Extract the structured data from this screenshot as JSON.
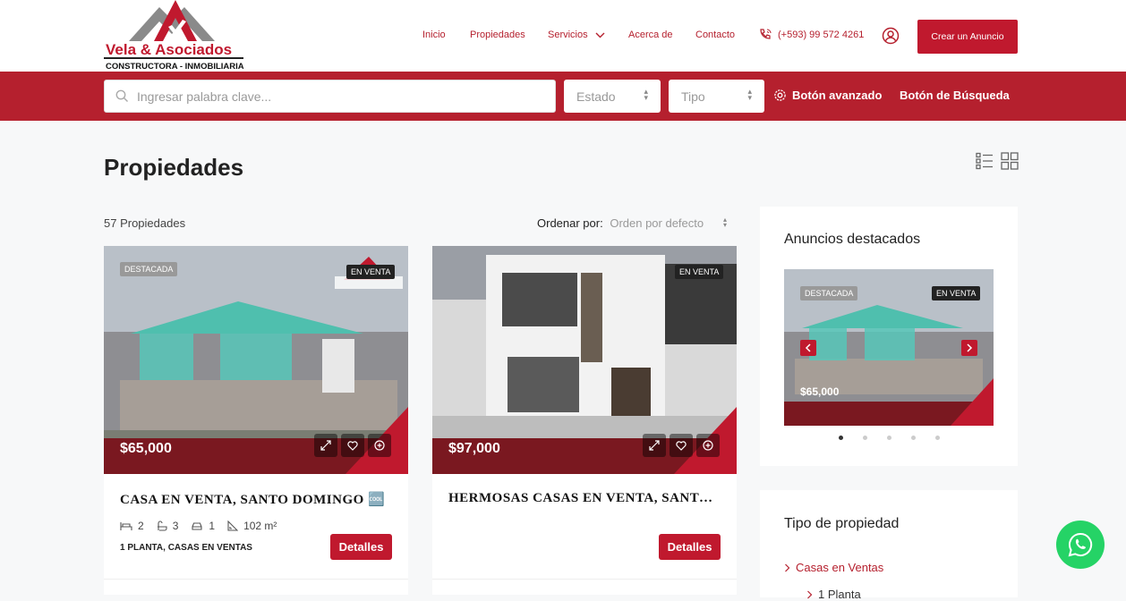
{
  "header": {
    "logo_brand": "Vela & Asociados",
    "logo_tagline": "CONSTRUCTORA - INMOBILIARIA",
    "nav": [
      {
        "label": "Inicio"
      },
      {
        "label": "Propiedades"
      },
      {
        "label": "Servicios"
      },
      {
        "label": "Acerca de"
      },
      {
        "label": "Contacto"
      }
    ],
    "phone": "(+593) 99 572 4261",
    "cta_label": "Crear un Anuncio"
  },
  "search": {
    "placeholder": "Ingresar palabra clave...",
    "estado_label": "Estado",
    "tipo_label": "Tipo",
    "advanced_label": "Botón avanzado",
    "search_label": "Botón de Búsqueda"
  },
  "main": {
    "title": "Propiedades",
    "count": "57 Propiedades",
    "sort_label": "Ordenar por:",
    "sort_value": "Orden por defecto"
  },
  "cards": [
    {
      "badge_featured": "DESTACADA",
      "badge_status": "EN VENTA",
      "price": "$65,000",
      "title": "CASA EN VENTA, SANTO DOMINGO 🆒",
      "beds": "2",
      "baths": "3",
      "garage": "1",
      "area": "102 m²",
      "category": "1 PLANTA, CASAS EN VENTAS",
      "details_label": "Detalles"
    },
    {
      "badge_status": "EN VENTA",
      "price": "$97,000",
      "title": "HERMOSAS CASAS EN VENTA, SANTO DOMINGO",
      "details_label": "Detalles"
    }
  ],
  "sidebar": {
    "featured_title": "Anuncios destacados",
    "featured_badge": "DESTACADA",
    "featured_status": "EN VENTA",
    "featured_price": "$65,000",
    "slide_count": 5,
    "active_slide": 1,
    "types_title": "Tipo de propiedad",
    "type_items": [
      {
        "label": "Casas en Ventas"
      },
      {
        "label": "1 Planta"
      }
    ]
  },
  "colors": {
    "brand_red": "#b5202e",
    "button_red": "#c0192e",
    "whatsapp": "#25d366"
  }
}
